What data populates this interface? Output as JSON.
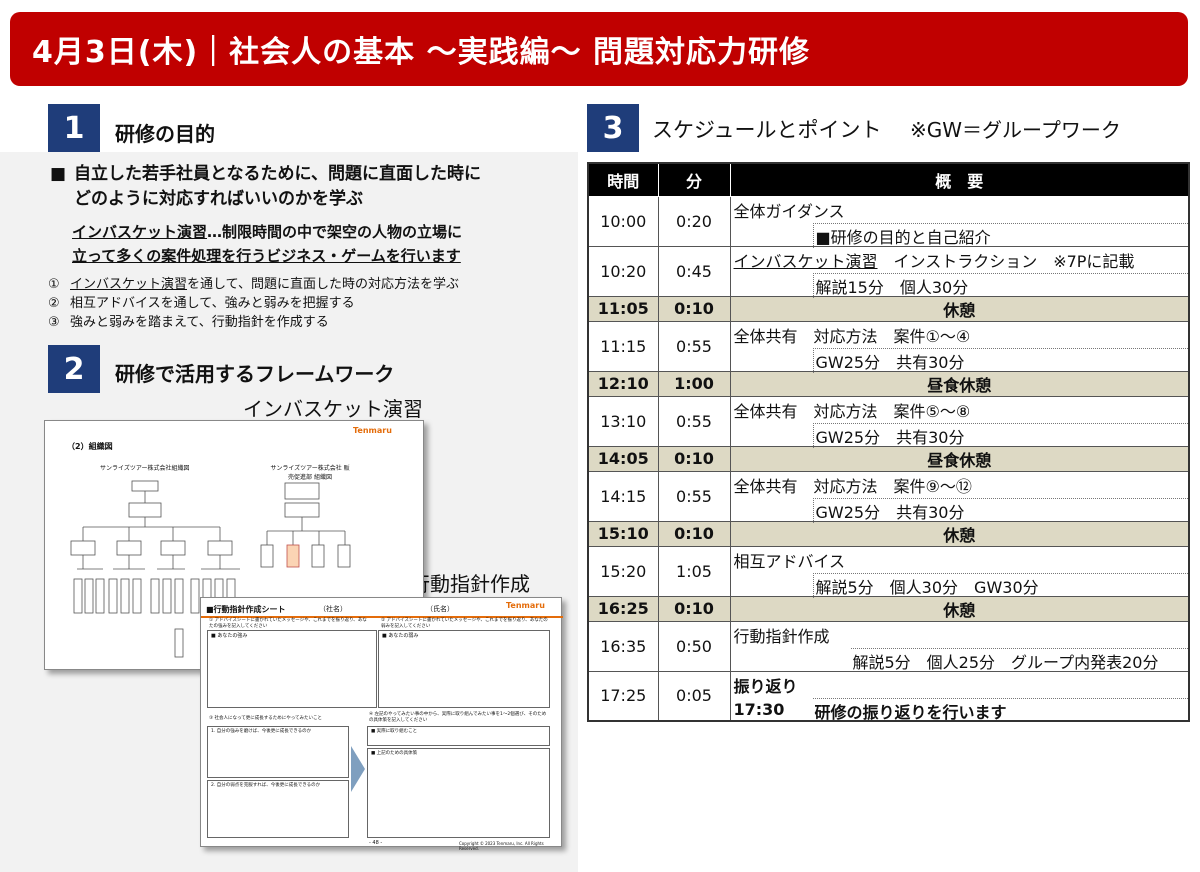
{
  "title": "4月3日(木)｜社会人の基本 ～実践編～ 問題対応力研修",
  "sec1": {
    "num": "1",
    "title": "研修の目的",
    "main_line1": "自立した若手社員となるために、問題に直面した時に",
    "main_line2": "どのように対応すればいいのかを学ぶ",
    "inbasket_term": "インバスケット演習",
    "inbasket_line1": "…制限時間の中で架空の人物の立場に",
    "inbasket_line2": "立って多くの案件処理を行うビジネス・ゲームを行います",
    "goals": [
      {
        "n": "①",
        "pre": "",
        "term": "インバスケット演習",
        "post": "を通して、問題に直面した時の対応方法を学ぶ"
      },
      {
        "n": "②",
        "pre": "相互アドバイスを通して、強みと弱みを把握する",
        "term": "",
        "post": ""
      },
      {
        "n": "③",
        "pre": "強みと弱みを踏まえて、行動指針を作成する",
        "term": "",
        "post": ""
      }
    ]
  },
  "sec2": {
    "num": "2",
    "title": "研修で活用するフレームワーク",
    "caption1": "インバスケット演習",
    "caption2": "行動指針作成",
    "thumb1": {
      "title": "（2）組織図",
      "brand": "Tenmaru",
      "org1": "サンライズツアー株式会社組織図",
      "org2": "サンライズツアー株式会社 販売促進部 組織図"
    },
    "thumb2": {
      "title": "■行動指針作成シート",
      "company": "（社名）",
      "name": "（氏名）",
      "brand": "Tenmaru",
      "q1": "① アドバイスシートに書かれていたメッセージや、これまでを振り返り、あなたの強みを記入してください",
      "q1b": "■ あなたの強み",
      "q2": "② アドバイスシートに書かれていたメッセージや、これまでを振り返り、あなたの弱みを記入してください",
      "q2b": "■ あなたの弱み",
      "q3": "③ 社会人になって更に成長するためにやってみたいこと",
      "q3a": "1. 自分の強みを磨けば、今後更に成長できるのか",
      "q3b": "2. 自分の弱点を克服すれば、今後更に成長できるのか",
      "q4": "④ 左記のやってみたい事の中から、実際に取り組んでみたい事を1～2個選び、そのための具体策を記入してください",
      "q4a": "■ 実際に取り組むこと",
      "q4b": "■ 上記のための具体策",
      "page": "- 48 -",
      "copyright": "Copyright © 2023 Tenmaru, Inc. All Rights Reserved."
    }
  },
  "sec3": {
    "num": "3",
    "title": "スケジュールとポイント",
    "note": "※GW＝グループワーク",
    "headers": {
      "time": "時間",
      "min": "分",
      "overview": "概　要"
    },
    "rows": [
      {
        "type": "norm",
        "time": "10:00",
        "min": "0:20",
        "l1": "全体ガイダンス",
        "l2": "■研修の目的と自己紹介",
        "indent": "a1"
      },
      {
        "type": "norm",
        "time": "10:20",
        "min": "0:45",
        "l1_term": "インバスケット演習",
        "l1": "　インストラクション　※7Pに記載",
        "l2": "解説15分　個人30分",
        "indent": "a1"
      },
      {
        "type": "brk",
        "time": "11:05",
        "min": "0:10",
        "label": "休憩"
      },
      {
        "type": "norm",
        "time": "11:15",
        "min": "0:55",
        "l1": "全体共有　対応方法　案件①～④",
        "l2": "GW25分　共有30分",
        "indent": "a1"
      },
      {
        "type": "brk",
        "time": "12:10",
        "min": "1:00",
        "label": "昼食休憩"
      },
      {
        "type": "norm",
        "time": "13:10",
        "min": "0:55",
        "l1": "全体共有　対応方法　案件⑤～⑧",
        "l2": "GW25分　共有30分",
        "indent": "a1"
      },
      {
        "type": "brk",
        "time": "14:05",
        "min": "0:10",
        "label": "昼食休憩"
      },
      {
        "type": "norm",
        "time": "14:15",
        "min": "0:55",
        "l1": "全体共有　対応方法　案件⑨～⑫",
        "l2": "GW25分　共有30分",
        "indent": "a1"
      },
      {
        "type": "brk",
        "time": "15:10",
        "min": "0:10",
        "label": "休憩"
      },
      {
        "type": "norm",
        "time": "15:20",
        "min": "1:05",
        "l1": "相互アドバイス",
        "l2": "解説5分　個人30分　GW30分",
        "indent": "a1"
      },
      {
        "type": "brk",
        "time": "16:25",
        "min": "0:10",
        "label": "休憩"
      },
      {
        "type": "norm",
        "time": "16:35",
        "min": "0:50",
        "l1": "行動指針作成",
        "l2": "解説5分　個人25分　グループ内発表20分",
        "indent": "a2"
      },
      {
        "type": "norm",
        "time": "17:25",
        "min": "0:05",
        "l1": "振り返り",
        "end_time": "17:30",
        "l2": "研修の振り返りを行います",
        "indent": "a1"
      }
    ]
  }
}
